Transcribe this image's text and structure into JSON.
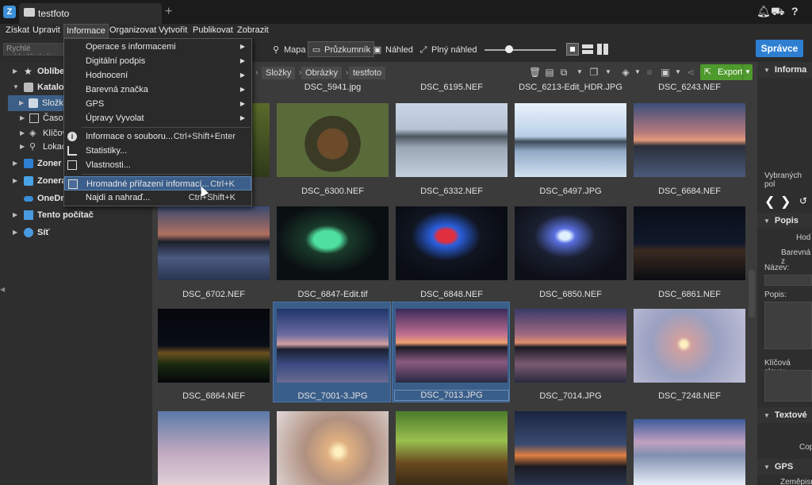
{
  "window": {
    "tab_title": "testfoto",
    "app_icon_letter": "Z"
  },
  "menubar": [
    "Získat",
    "Upravit",
    "Informace",
    "Organizovat",
    "Vytvořit",
    "Publikovat",
    "Zobrazit"
  ],
  "toolbar": {
    "search_placeholder": "Rychlé vyhledávání",
    "modes": [
      "Mapa",
      "Průzkumník",
      "Náhled",
      "Plný náhled"
    ],
    "manager_button": "Správce",
    "export_button": "Export"
  },
  "breadcrumb": [
    "Složky",
    "Obrázky",
    "testfoto"
  ],
  "sidebar": {
    "items": [
      {
        "label": "Oblíbe",
        "bold": true
      },
      {
        "label": "Katalo",
        "bold": true
      },
      {
        "label": "Složky",
        "bold": false,
        "selected": true
      },
      {
        "label": "Časov",
        "bold": false
      },
      {
        "label": "Klíčov",
        "bold": false
      },
      {
        "label": "Lokac",
        "bold": false
      },
      {
        "label": "Zoner",
        "bold": true
      },
      {
        "label": "Zonera",
        "bold": true
      },
      {
        "label": "OneDr",
        "bold": true
      },
      {
        "label": "Tento počítač",
        "bold": true
      },
      {
        "label": "Síť",
        "bold": true
      }
    ]
  },
  "info_menu": {
    "items": [
      {
        "label": "Operace s informacemi",
        "shortcut": "",
        "submenu": true
      },
      {
        "label": "Digitální podpis",
        "shortcut": "",
        "submenu": true
      },
      {
        "label": "Hodnocení",
        "shortcut": "",
        "submenu": true
      },
      {
        "label": "Barevná značka",
        "shortcut": "",
        "submenu": true
      },
      {
        "label": "GPS",
        "shortcut": "",
        "submenu": true
      },
      {
        "label": "Úpravy Vyvolat",
        "shortcut": "",
        "submenu": true
      },
      {
        "label": "Informace o souboru...",
        "shortcut": "Ctrl+Shift+Enter",
        "submenu": false
      },
      {
        "label": "Statistiky...",
        "shortcut": "",
        "submenu": false
      },
      {
        "label": "Vlastnosti...",
        "shortcut": "",
        "submenu": false
      },
      {
        "label": "Hromadné přiřazení informací...",
        "shortcut": "Ctrl+K",
        "submenu": false,
        "highlighted": true
      },
      {
        "label": "Najdi a nahraď...",
        "shortcut": "Ctrl+Shift+K",
        "submenu": false
      }
    ]
  },
  "top_filenames": [
    "DSC_5941.jpg",
    "DSC_6195.NEF",
    "DSC_6213-Edit_HDR.JPG",
    "DSC_6243.NEF"
  ],
  "files": [
    {
      "name": "DSC_6300.NEF",
      "selected": false
    },
    {
      "name": "DSC_6332.NEF",
      "selected": false
    },
    {
      "name": "DSC_6497.JPG",
      "selected": false
    },
    {
      "name": "DSC_6684.NEF",
      "selected": false
    },
    {
      "name": "DSC_6702.NEF",
      "selected": false
    },
    {
      "name": "DSC_6847-Edit.tif",
      "selected": false
    },
    {
      "name": "DSC_6848.NEF",
      "selected": false
    },
    {
      "name": "DSC_6850.NEF",
      "selected": false
    },
    {
      "name": "DSC_6861.NEF",
      "selected": false
    },
    {
      "name": "DSC_6864.NEF",
      "selected": false
    },
    {
      "name": "DSC_7001-3.JPG",
      "selected": true
    },
    {
      "name": "DSC_7013.JPG",
      "selected": true
    },
    {
      "name": "DSC_7014.JPG",
      "selected": false
    },
    {
      "name": "DSC_7248.NEF",
      "selected": false
    }
  ],
  "right_panel": {
    "info_section": "Informa",
    "selected_text": "Vybraných pol",
    "description_section": "Popis",
    "rating_label": "Hod",
    "color_label": "Barevná z",
    "name_label": "Název:",
    "desc_label": "Popis:",
    "keywords_label": "Klíčová slova:",
    "text_section": "Textové",
    "copyright_label": "Cop",
    "gps_section": "GPS",
    "lat_label": "Zeměpisn"
  },
  "colors": {
    "accent": "#2e7fd1",
    "export": "#4e9a2c",
    "selection": "#3b5f8a"
  }
}
